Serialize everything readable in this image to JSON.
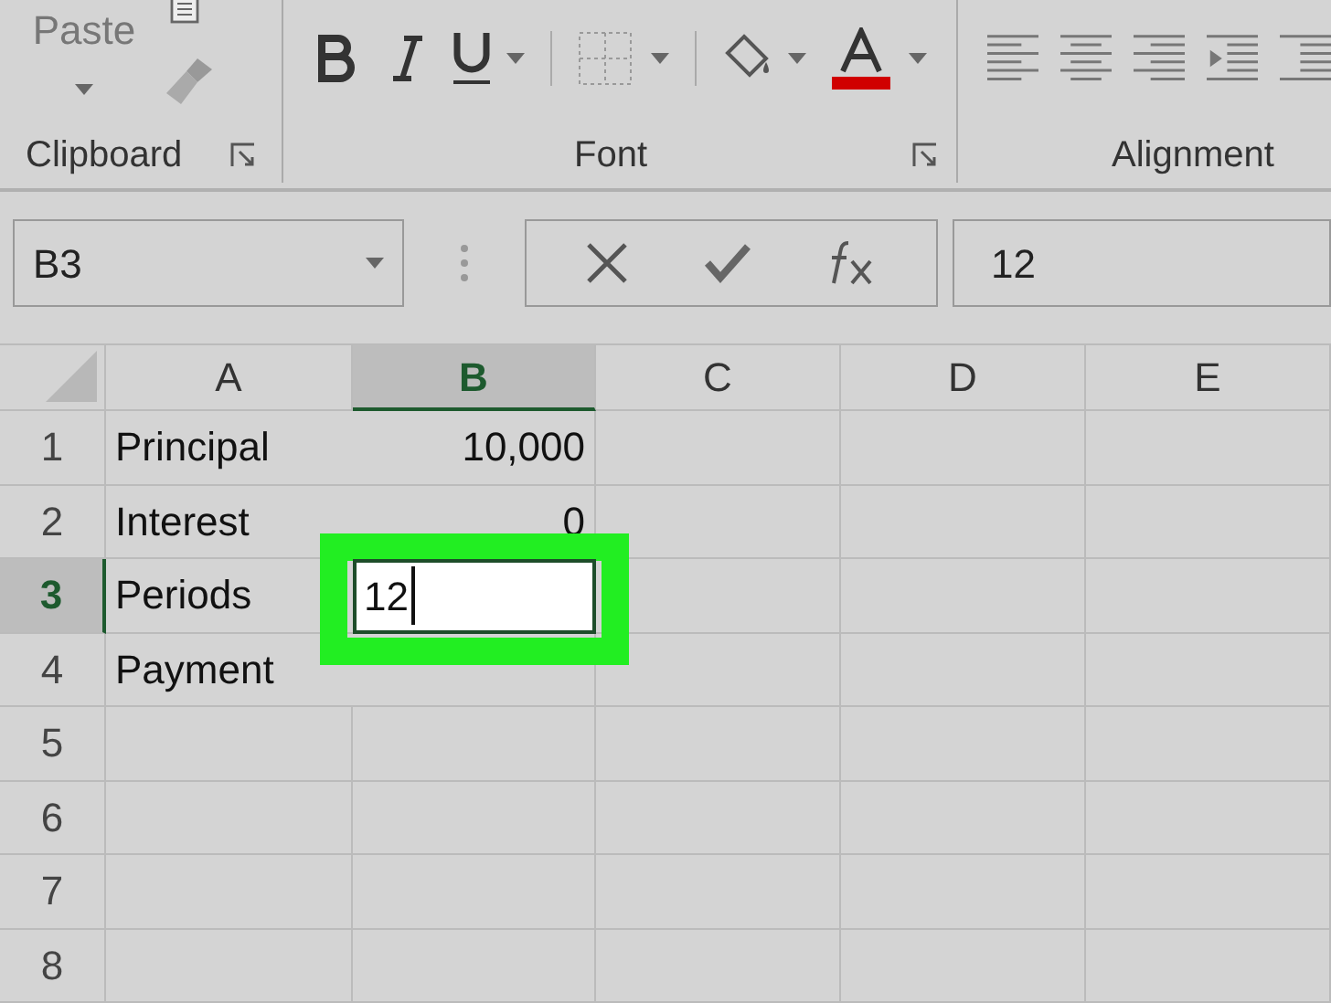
{
  "ribbon": {
    "groups": [
      {
        "kind": "clipboard",
        "label": "Clipboard",
        "button": "Paste"
      },
      {
        "kind": "font",
        "label": "Font"
      },
      {
        "kind": "alignment",
        "label": "Alignment"
      }
    ]
  },
  "formula_bar": {
    "name_box": "B3",
    "value": "12"
  },
  "columns": [
    {
      "label": "A",
      "selected": false
    },
    {
      "label": "B",
      "selected": true
    },
    {
      "label": "C",
      "selected": false
    },
    {
      "label": "D",
      "selected": false
    },
    {
      "label": "E",
      "selected": false
    }
  ],
  "rows": [
    {
      "header": "1",
      "selected": false,
      "cells": [
        {
          "text": "Principal",
          "editing": false
        },
        {
          "text": "10,000",
          "editing": false
        }
      ]
    },
    {
      "header": "2",
      "selected": false,
      "cells": [
        {
          "text": "Interest",
          "editing": false
        },
        {
          "text": "0",
          "editing": false
        }
      ]
    },
    {
      "header": "3",
      "selected": true,
      "cells": [
        {
          "text": "Periods",
          "editing": false
        },
        {
          "text": "12",
          "editing": true
        }
      ]
    },
    {
      "header": "4",
      "selected": false,
      "cells": [
        {
          "text": "Payment",
          "editing": false
        }
      ]
    },
    {
      "header": "5",
      "selected": false
    },
    {
      "header": "6",
      "selected": false
    },
    {
      "header": "7",
      "selected": false
    },
    {
      "header": "8",
      "selected": false
    }
  ]
}
